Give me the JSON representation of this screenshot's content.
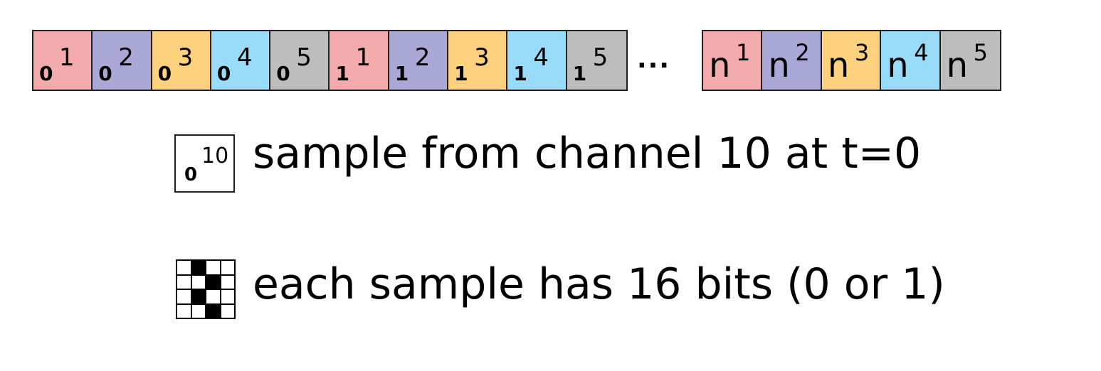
{
  "cells_left": [
    {
      "sub": "0",
      "sup": "1",
      "color": "#f4abab"
    },
    {
      "sub": "0",
      "sup": "2",
      "color": "#a9a8d6"
    },
    {
      "sub": "0",
      "sup": "3",
      "color": "#fdd17e"
    },
    {
      "sub": "0",
      "sup": "4",
      "color": "#99dcf9"
    },
    {
      "sub": "0",
      "sup": "5",
      "color": "#bdbdbd"
    },
    {
      "sub": "1",
      "sup": "1",
      "color": "#f4abab"
    },
    {
      "sub": "1",
      "sup": "2",
      "color": "#a9a8d6"
    },
    {
      "sub": "1",
      "sup": "3",
      "color": "#fdd17e"
    },
    {
      "sub": "1",
      "sup": "4",
      "color": "#99dcf9"
    },
    {
      "sub": "1",
      "sup": "5",
      "color": "#bdbdbd"
    }
  ],
  "ellipsis": "...",
  "cells_right": [
    {
      "sub": "n",
      "sup": "1",
      "color": "#f4abab"
    },
    {
      "sub": "n",
      "sup": "2",
      "color": "#a9a8d6"
    },
    {
      "sub": "n",
      "sup": "3",
      "color": "#fdd17e"
    },
    {
      "sub": "n",
      "sup": "4",
      "color": "#99dcf9"
    },
    {
      "sub": "n",
      "sup": "5",
      "color": "#bdbdbd"
    }
  ],
  "legend": {
    "sample": {
      "sub": "0",
      "sup": "10",
      "text": "sample from channel 10 at t=0"
    },
    "bits": {
      "text": "each sample has 16 bits (0 or 1)",
      "grid": [
        [
          0,
          1,
          0,
          0
        ],
        [
          0,
          0,
          1,
          0
        ],
        [
          0,
          1,
          0,
          0
        ],
        [
          0,
          0,
          1,
          0
        ]
      ]
    }
  }
}
